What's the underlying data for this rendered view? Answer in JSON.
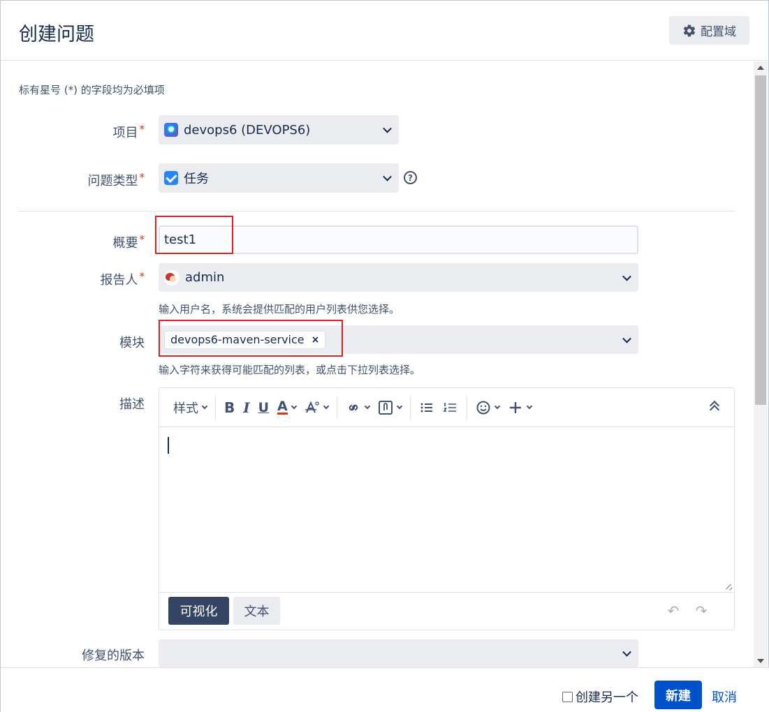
{
  "header": {
    "title": "创建问题",
    "config_label": "配置域"
  },
  "form": {
    "required_note": "标有星号 (*) 的字段均为必填项",
    "project": {
      "label": "项目",
      "value": "devops6 (DEVOPS6)"
    },
    "issue_type": {
      "label": "问题类型",
      "value": "任务"
    },
    "summary": {
      "label": "概要",
      "value": "test1"
    },
    "reporter": {
      "label": "报告人",
      "value": "admin",
      "hint": "输入用户名，系统会提供匹配的用户列表供您选择。"
    },
    "component": {
      "label": "模块",
      "tag": "devops6-maven-service",
      "tag_remove": "×",
      "hint": "输入字符来获得可能匹配的列表，或点击下拉列表选择。"
    },
    "description": {
      "label": "描述",
      "toolbar": {
        "style": "样式",
        "bold": "B",
        "italic": "I",
        "underline": "U",
        "color": "A"
      },
      "mode_visual": "可视化",
      "mode_text": "文本"
    },
    "fix_version": {
      "label": "修复的版本",
      "value": ""
    }
  },
  "footer": {
    "create_another": "创建另一个",
    "create": "新建",
    "cancel": "取消"
  },
  "colors": {
    "primary": "#0052cc",
    "required": "#de350b",
    "highlight": "#e02020"
  }
}
